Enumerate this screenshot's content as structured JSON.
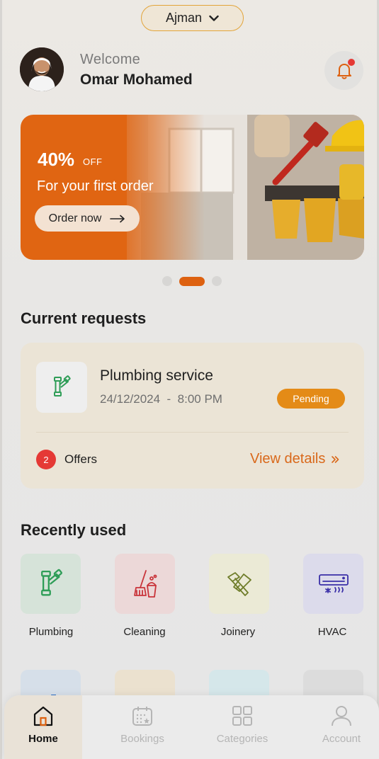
{
  "location": {
    "selected": "Ajman"
  },
  "header": {
    "welcome": "Welcome",
    "user_name": "Omar Mohamed"
  },
  "banner": {
    "percent": "40%",
    "off": "OFF",
    "subtitle": "For your first order",
    "button_label": "Order now"
  },
  "carousel": {
    "count": 3,
    "active_index": 1
  },
  "current_requests": {
    "title": "Current requests",
    "items": [
      {
        "service": "Plumbing service",
        "date": "24/12/2024",
        "time": "8:00 PM",
        "status": "Pending",
        "offers_count": "2",
        "offers_label": "Offers",
        "details_label": "View details"
      }
    ]
  },
  "recently_used": {
    "title": "Recently used",
    "items": [
      {
        "label": "Plumbing",
        "icon": "pipe-icon",
        "bg": "#d6e3d9"
      },
      {
        "label": "Cleaning",
        "icon": "mop-bucket-icon",
        "bg": "#ecd8d8"
      },
      {
        "label": "Joinery",
        "icon": "saw-hammer-icon",
        "bg": "#ebead6"
      },
      {
        "label": "HVAC",
        "icon": "air-conditioner-icon",
        "bg": "#dcdbeb"
      }
    ]
  },
  "bottom_nav": {
    "items": [
      {
        "label": "Home",
        "icon": "home-icon",
        "active": true
      },
      {
        "label": "Bookings",
        "icon": "calendar-icon",
        "active": false
      },
      {
        "label": "Categories",
        "icon": "grid-icon",
        "active": false
      },
      {
        "label": "Account",
        "icon": "user-icon",
        "active": false
      }
    ]
  },
  "colors": {
    "accent": "#dd6110",
    "badge": "#e48b17",
    "notification": "#e53935"
  }
}
